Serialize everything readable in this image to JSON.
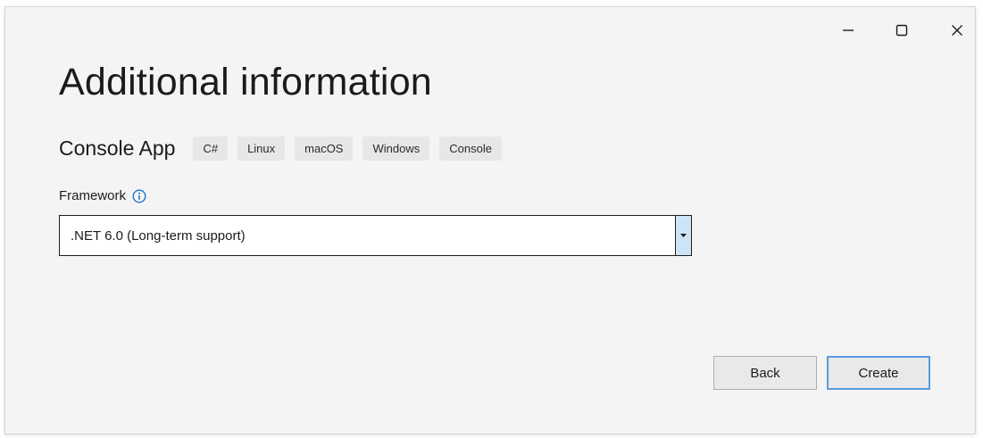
{
  "window": {
    "controls": {
      "minimize_icon": "minimize-icon",
      "maximize_icon": "maximize-icon",
      "close_icon": "close-icon"
    }
  },
  "header": {
    "title": "Additional information"
  },
  "project": {
    "name": "Console App",
    "tags": [
      "C#",
      "Linux",
      "macOS",
      "Windows",
      "Console"
    ]
  },
  "framework": {
    "label": "Framework",
    "info_icon": "info-icon",
    "selected_value": ".NET 6.0 (Long-term support)"
  },
  "footer": {
    "back_label": "Back",
    "create_label": "Create"
  },
  "colors": {
    "accent": "#5b9be0",
    "info_icon": "#1a73c9",
    "dropdown_arrow_bg": "#cde4f7"
  }
}
